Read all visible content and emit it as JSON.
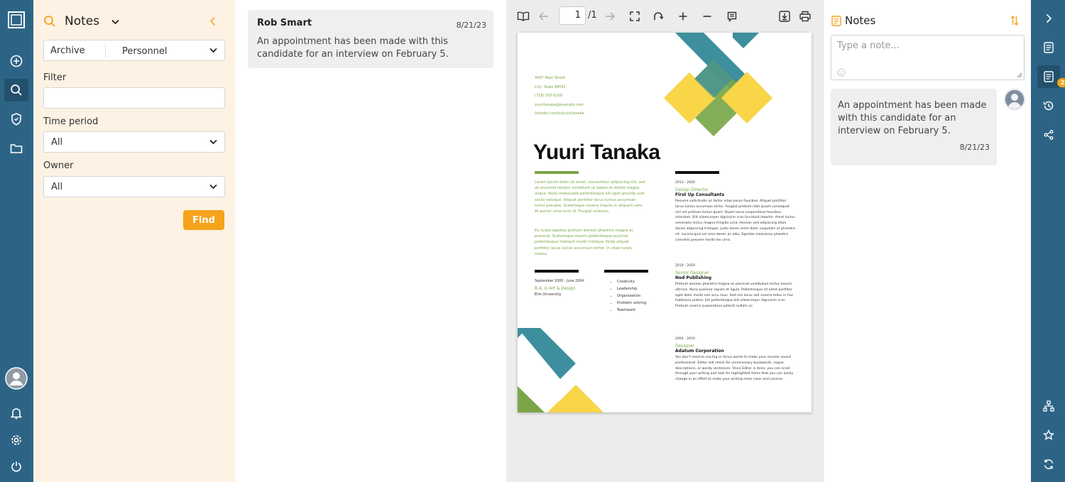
{
  "search_panel": {
    "title": "Notes",
    "archive_label": "Archive",
    "archive_value": "Personnel",
    "filter_label": "Filter",
    "filter_value": "",
    "time_period_label": "Time period",
    "time_period_value": "All",
    "owner_label": "Owner",
    "owner_value": "All",
    "find_label": "Find"
  },
  "results": [
    {
      "author": "Rob Smart",
      "date": "8/21/23",
      "text": "An appointment has been made with this candidate for an interview on February 5."
    }
  ],
  "viewer": {
    "page_current": "1",
    "page_total": "/1"
  },
  "document": {
    "contact": [
      "4567 Main Street",
      "City, State 98052",
      "(718) 555-0100",
      "yuuritanaka@example.com",
      "linkedin.com/in/yuuritanaka"
    ],
    "name": "Yuuri Tanaka",
    "intro_1": "Lorem ipsum dolor sit amet, consectetur adipiscing elit, sed do eiusmod tempor incididunt ut labore et dolore magna aliqua. Nulla malesuada pellentesque elit eget gravida cum sociis natoque. Aliquet porttitor lacus luctus accumsan tortor posuere. Scelerisque viverra mauris in aliquam sem. At auctor urna nunc id. Feugiat vivamus.",
    "intro_2": "Eu turpis egestas pretium aenean pharetra magna ac placerat. Scelerisque mauris pellentesque pulvinar pellentesque habitant morbi tristique. Nulla aliquet porttitor lacus luctus accumsan tortor. In vitae turpis massa.",
    "education_dates": "September 2000 - June 2004",
    "education_degree": "B.A. in Art & Design",
    "education_school": "Elm University",
    "skills": [
      "Creativity",
      "Leadership",
      "Organization",
      "Problem solving",
      "Teamwork"
    ],
    "jobs": [
      {
        "dates": "2013 - 2020",
        "title": "Design Director",
        "company": "First Up Consultants",
        "text": "Posuere sollicitudin ac tortor vitae purus faucibus. Aliquet porttitor lacus luctus accumsan tortor. Feugiat pretium nibh ipsum consequat nisl vel pretium lectus quam. Quam lacus suspendisse faucibus interdum. Elit ullamcorper dignissim cras tincidunt lobortis. Amet luctus venenatis lectus magna fringilla urna. Aenean sed adipiscing diam donec adipiscing tristique. Justo donec enim diam vulputate ut pharetra sit. Lacinia quis vel eros donec ac odio. Egestas maecenas pharetra convallis posuere morbi leo urna."
      },
      {
        "dates": "2010 - 2019",
        "title": "Senior Designer",
        "company": "Nod Publishing",
        "text": "Pretium aenean pharetra magna ac placerat vestibulum lectus mauris ultrices. Nunc pulvinar sapien et ligula. Pellentesque sit amet porttitor eget dolor morbi non arcu risus. Sed nisi lacus sed viverra tellus in hac habitasse platea. Est pellentesque elit ullamcorper dignissim cras. Pretium viverra suspendisse potenti nullam ac."
      },
      {
        "dates": "2004 - 2010",
        "title": "Designer",
        "company": "Adatum Corporation",
        "text": "You don't need to use big or fancy words to make your resume sound professional. Editor will check for unnecessary buzzwords, vague descriptions, or wordy sentences. Once Editor is done, you can scroll through your writing and look for highlighted items that you can easily change in an effort to make your writing more clear and concise."
      }
    ]
  },
  "notes_panel": {
    "title": "Notes",
    "placeholder": "Type a note...",
    "note_text": "An appointment has been made with this candidate for an interview on February 5.",
    "note_date": "8/21/23",
    "badge_count": "2"
  },
  "colors": {
    "rail": "#2d6486",
    "accent": "#f5a31a",
    "panel_bg": "#fdf2e3",
    "resume_green": "#7aa649",
    "resume_teal": "#3d8f9e",
    "resume_yellow": "#f9d548"
  }
}
